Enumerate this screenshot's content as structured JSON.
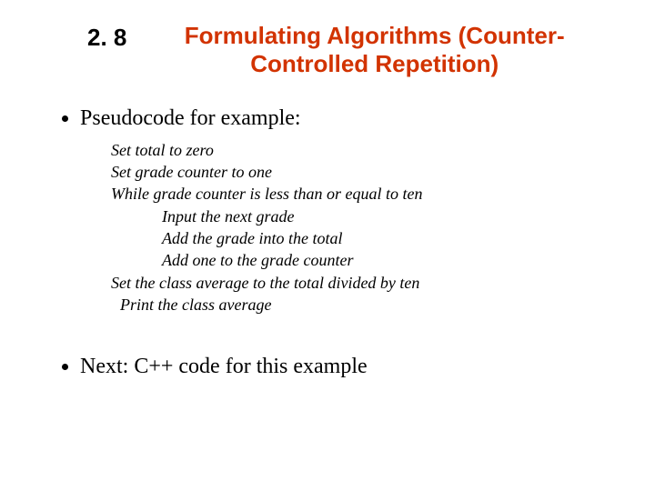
{
  "header": {
    "section_number": "2. 8",
    "title_line1": "Formulating Algorithms (Counter-",
    "title_line2": "Controlled Repetition)"
  },
  "bullets": {
    "b1": "Pseudocode for example:",
    "b2": "Next: C++ code for this example"
  },
  "pseudo": {
    "l1": "Set total to zero",
    "l2": "Set grade counter to one",
    "l3": "While grade counter is less than or equal to ten",
    "l4": "Input the next grade",
    "l5": "Add the grade into the total",
    "l6": "Add one to the grade counter",
    "l7": "Set the class average to the total divided by ten",
    "l8": "Print the class average"
  }
}
